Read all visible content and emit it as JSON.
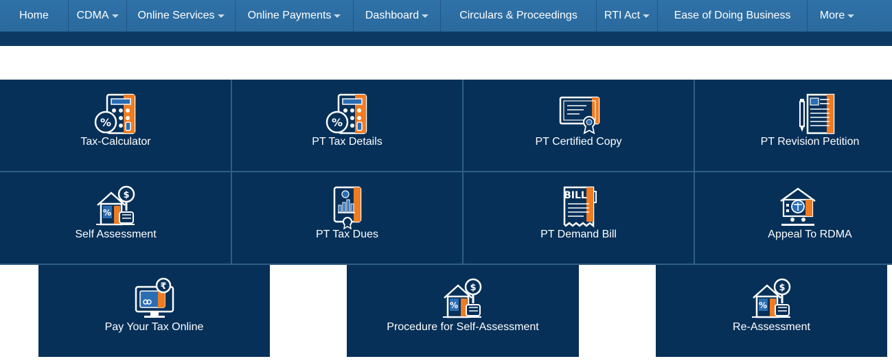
{
  "nav": {
    "items": [
      {
        "label": "Home",
        "dropdown": false
      },
      {
        "label": "CDMA",
        "dropdown": true
      },
      {
        "label": "Online Services",
        "dropdown": true
      },
      {
        "label": "Online Payments",
        "dropdown": true
      },
      {
        "label": "Dashboard",
        "dropdown": true
      },
      {
        "label": "Circulars & Proceedings",
        "dropdown": false
      },
      {
        "label": "RTI Act",
        "dropdown": true
      },
      {
        "label": "Ease of Doing Business",
        "dropdown": false
      },
      {
        "label": "More",
        "dropdown": true
      }
    ]
  },
  "services": {
    "row1": [
      {
        "label": "Tax-Calculator",
        "icon": "calculator-icon"
      },
      {
        "label": "PT Tax Details",
        "icon": "calculator-icon"
      },
      {
        "label": "PT Certified Copy",
        "icon": "certificate-icon"
      },
      {
        "label": "PT Revision Petition",
        "icon": "document-pen-icon"
      }
    ],
    "row2": [
      {
        "label": "Self Assessment",
        "icon": "house-magnifier-icon"
      },
      {
        "label": "PT Tax Dues",
        "icon": "report-document-icon"
      },
      {
        "label": "PT Demand Bill",
        "icon": "bill-icon"
      },
      {
        "label": "Appeal To RDMA",
        "icon": "court-icon"
      }
    ],
    "row3": [
      {
        "label": "Pay Your Tax Online",
        "icon": "online-payment-icon"
      },
      {
        "label": "Procedure for Self-Assessment",
        "icon": "house-magnifier-icon"
      },
      {
        "label": "Re-Assessment",
        "icon": "house-magnifier-icon"
      }
    ]
  },
  "colors": {
    "navbar": "#2f72a9",
    "tile": "#063058",
    "accent": "#f07c22"
  }
}
